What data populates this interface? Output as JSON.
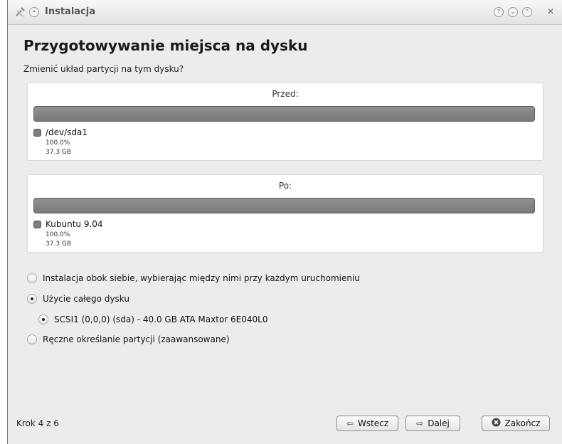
{
  "window": {
    "title": "Instalacja",
    "icons": {
      "app": "wrench-hammer-icon",
      "pin": "pin-icon",
      "help": "help-icon",
      "minimize": "minimize-icon",
      "maximize": "maximize-icon",
      "close": "close-icon"
    }
  },
  "page": {
    "title": "Przygotowywanie miejsca na dysku",
    "question": "Zmienić układ partycji na tym dysku?"
  },
  "before": {
    "label": "Przed:",
    "partition": {
      "name": "/dev/sda1",
      "percent": "100.0%",
      "size": "37.3 GB"
    }
  },
  "after": {
    "label": "Po:",
    "partition": {
      "name": "Kubuntu 9.04",
      "percent": "100.0%",
      "size": "37.3 GB"
    }
  },
  "options": [
    {
      "label": "Instalacja obok siebie, wybierając między nimi przy każdym uruchomieniu",
      "checked": false
    },
    {
      "label": "Użycie całego dysku",
      "checked": true
    },
    {
      "label": "SCSI1 (0,0,0) (sda) - 40.0 GB ATA Maxtor 6E040L0",
      "checked": true
    },
    {
      "label": "Ręczne określanie partycji (zaawansowane)",
      "checked": false
    }
  ],
  "footer": {
    "step": "Krok 4 z 6",
    "back_label": "Wstecz",
    "next_label": "Dalej",
    "quit_label": "Zakończ"
  },
  "colors": {
    "bar": "#868686",
    "window_bg": "#ececec",
    "panel_bg": "#ffffff"
  }
}
